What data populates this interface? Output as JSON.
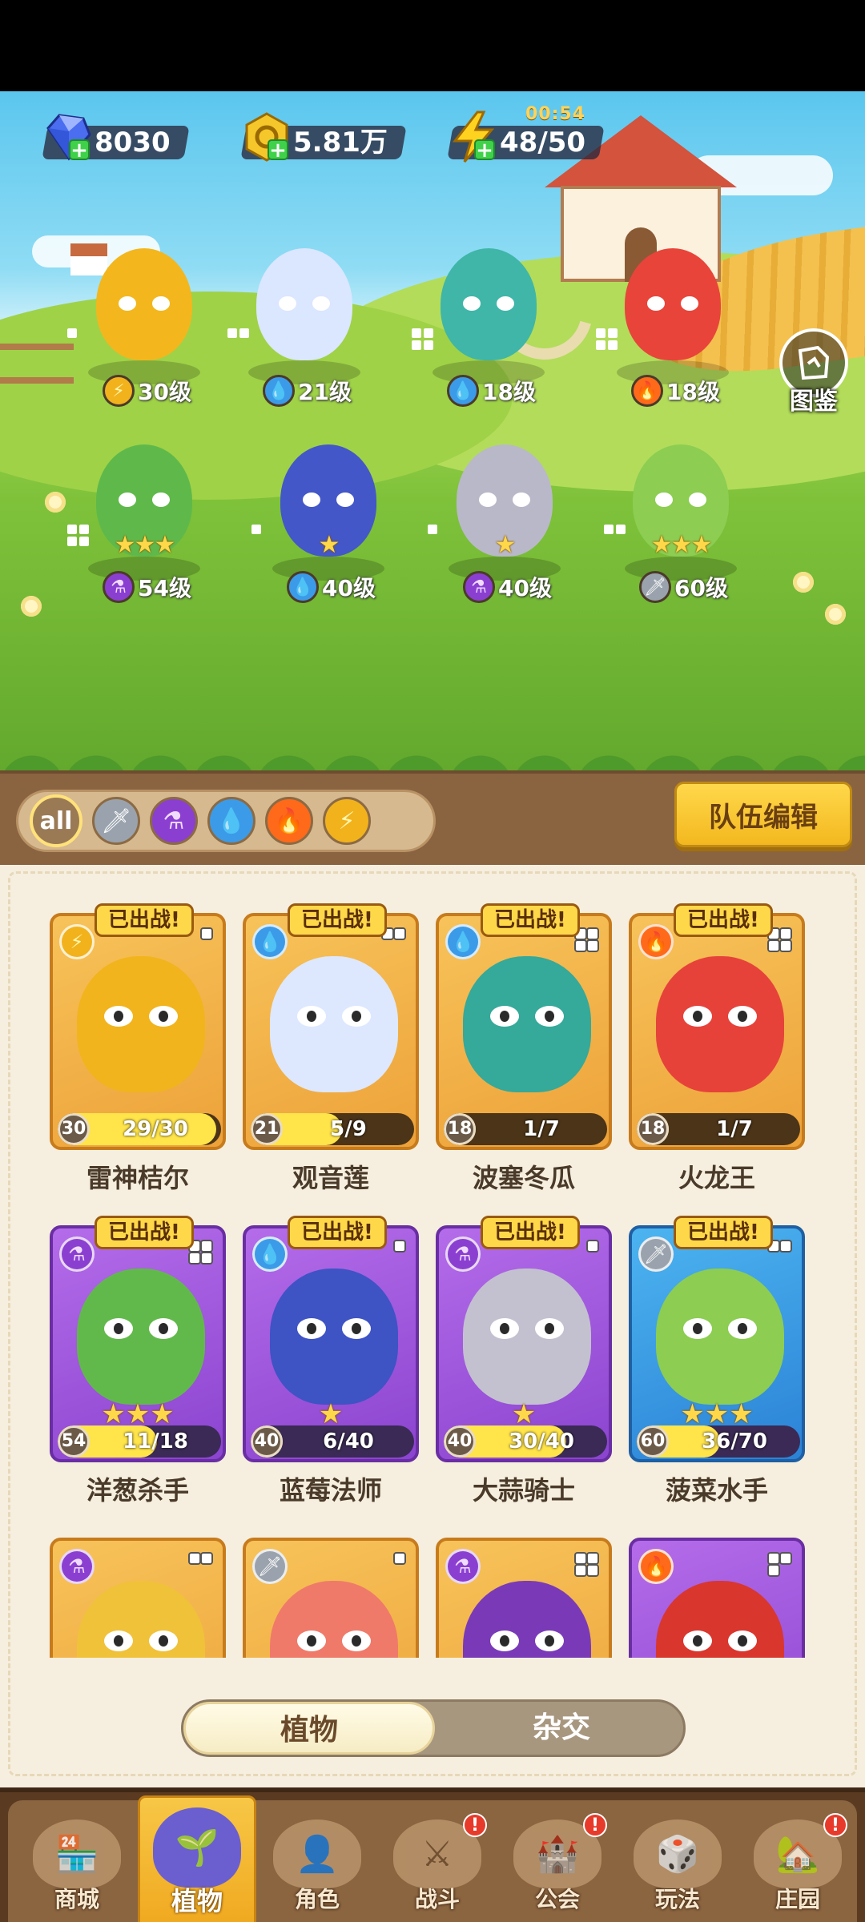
{
  "currencies": {
    "gems": "8030",
    "coins": "5.81万",
    "energy": "48/50",
    "energy_timer": "00:54"
  },
  "codex_label": "图鉴",
  "scene_plants": [
    {
      "element": "thunder",
      "level": "30级",
      "stars": ""
    },
    {
      "element": "water",
      "level": "21级",
      "stars": ""
    },
    {
      "element": "water",
      "level": "18级",
      "stars": ""
    },
    {
      "element": "fire",
      "level": "18级",
      "stars": ""
    },
    {
      "element": "potion",
      "level": "54级",
      "stars": "★★★"
    },
    {
      "element": "water",
      "level": "40级",
      "stars": "★"
    },
    {
      "element": "potion",
      "level": "40级",
      "stars": "★"
    },
    {
      "element": "sword",
      "level": "60级",
      "stars": "★★★"
    }
  ],
  "filters": {
    "all_label": "all",
    "items": [
      "sword",
      "potion",
      "water",
      "fire",
      "thunder"
    ]
  },
  "team_edit_label": "队伍编辑",
  "deployed_label": "已出战!",
  "cards": [
    {
      "name": "雷神桔尔",
      "level": "30",
      "progress": "29/30",
      "ratio": 0.97,
      "element": "thunder",
      "color": "orange",
      "stars": "",
      "deployed": true
    },
    {
      "name": "观音莲",
      "level": "21",
      "progress": "5/9",
      "ratio": 0.56,
      "element": "water",
      "color": "orange",
      "stars": "",
      "deployed": true
    },
    {
      "name": "波塞冬瓜",
      "level": "18",
      "progress": "1/7",
      "ratio": 0.14,
      "element": "water",
      "color": "orange",
      "stars": "",
      "deployed": true
    },
    {
      "name": "火龙王",
      "level": "18",
      "progress": "1/7",
      "ratio": 0.14,
      "element": "fire",
      "color": "orange",
      "stars": "",
      "deployed": true
    },
    {
      "name": "洋葱杀手",
      "level": "54",
      "progress": "11/18",
      "ratio": 0.61,
      "element": "potion",
      "color": "purple",
      "stars": "★★★",
      "deployed": true
    },
    {
      "name": "蓝莓法师",
      "level": "40",
      "progress": "6/40",
      "ratio": 0.15,
      "element": "water",
      "color": "purple",
      "stars": "★",
      "deployed": true
    },
    {
      "name": "大蒜骑士",
      "level": "40",
      "progress": "30/40",
      "ratio": 0.75,
      "element": "potion",
      "color": "purple",
      "stars": "★",
      "deployed": true
    },
    {
      "name": "菠菜水手",
      "level": "60",
      "progress": "36/70",
      "ratio": 0.51,
      "element": "sword",
      "color": "blue",
      "stars": "★★★",
      "deployed": true
    },
    {
      "name": "",
      "level": "",
      "progress": "",
      "ratio": 0,
      "element": "potion",
      "color": "orange",
      "stars": "",
      "deployed": false
    },
    {
      "name": "",
      "level": "",
      "progress": "",
      "ratio": 0,
      "element": "sword",
      "color": "orange",
      "stars": "",
      "deployed": false
    },
    {
      "name": "",
      "level": "",
      "progress": "",
      "ratio": 0,
      "element": "potion",
      "color": "orange",
      "stars": "",
      "deployed": false
    },
    {
      "name": "",
      "level": "",
      "progress": "",
      "ratio": 0,
      "element": "fire",
      "color": "purple",
      "stars": "",
      "deployed": false
    }
  ],
  "toggle": {
    "plants": "植物",
    "hybrid": "杂交"
  },
  "nav": [
    {
      "label": "商城",
      "alert": false,
      "active": false
    },
    {
      "label": "植物",
      "alert": false,
      "active": true
    },
    {
      "label": "角色",
      "alert": false,
      "active": false
    },
    {
      "label": "战斗",
      "alert": true,
      "active": false
    },
    {
      "label": "公会",
      "alert": true,
      "active": false
    },
    {
      "label": "玩法",
      "alert": false,
      "active": false
    },
    {
      "label": "庄园",
      "alert": true,
      "active": false
    }
  ],
  "colors": {
    "thunder": "#f2b21c",
    "water": "#3b9be8",
    "fire": "#ff6a1a",
    "potion": "#8b3fd1",
    "sword": "#9aa3ad"
  },
  "icons": {
    "thunder": "⚡",
    "water": "💧",
    "fire": "🔥",
    "potion": "⚗",
    "sword": "🗡"
  }
}
